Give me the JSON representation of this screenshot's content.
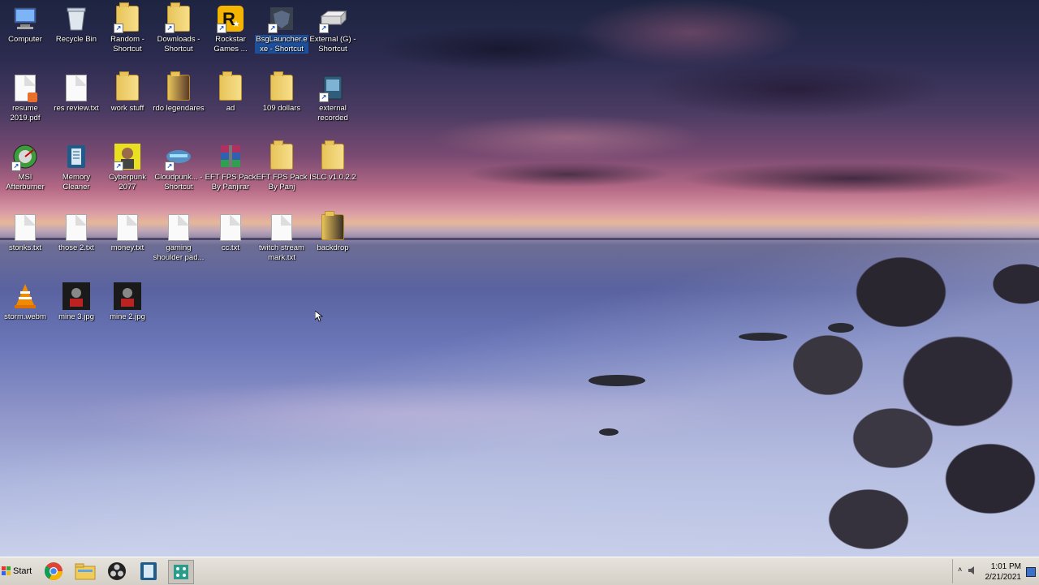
{
  "desktop": {
    "icons": [
      {
        "label": "Computer"
      },
      {
        "label": "Recycle Bin"
      },
      {
        "label": "Random - Shortcut"
      },
      {
        "label": "Downloads - Shortcut"
      },
      {
        "label": "Rockstar Games ..."
      },
      {
        "label": "BsgLauncher.exe - Shortcut"
      },
      {
        "label": "External (G) - Shortcut"
      },
      {
        "label": "resume 2019.pdf"
      },
      {
        "label": "res review.txt"
      },
      {
        "label": "work stuff"
      },
      {
        "label": "rdo legendares"
      },
      {
        "label": "ad"
      },
      {
        "label": "109 dollars"
      },
      {
        "label": "external recorded"
      },
      {
        "label": "MSI Afterburner"
      },
      {
        "label": "Memory Cleaner"
      },
      {
        "label": "Cyberpunk 2077"
      },
      {
        "label": "Cloudpunk... - Shortcut"
      },
      {
        "label": "EFT FPS Pack By Panjirar"
      },
      {
        "label": "EFT FPS Pack By Panj"
      },
      {
        "label": "ISLC v1.0.2.2"
      },
      {
        "label": "stonks.txt"
      },
      {
        "label": "those 2.txt"
      },
      {
        "label": "money.txt"
      },
      {
        "label": "gaming shoulder pad..."
      },
      {
        "label": "cc.txt"
      },
      {
        "label": "twitch stream mark.txt"
      },
      {
        "label": "backdrop"
      },
      {
        "label": "storm.webm"
      },
      {
        "label": "mine 3.jpg"
      },
      {
        "label": "mine 2.jpg"
      }
    ]
  },
  "taskbar": {
    "start_label": "Start",
    "pinned": [
      "chrome-icon",
      "explorer-icon",
      "obs-icon",
      "memory-cleaner-icon",
      "network-tool-icon"
    ],
    "clock": {
      "time": "1:01 PM",
      "date": "2/21/2021"
    }
  }
}
